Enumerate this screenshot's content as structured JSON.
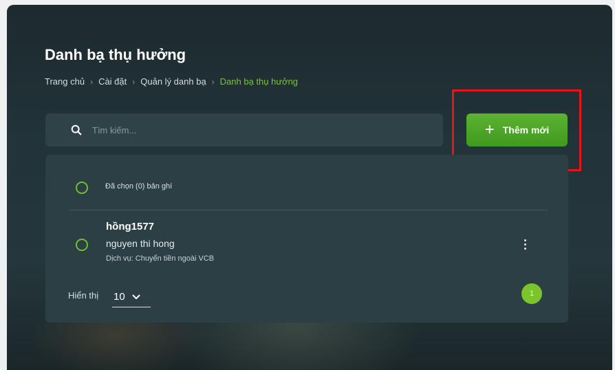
{
  "page": {
    "title": "Danh bạ thụ hưởng"
  },
  "breadcrumb": [
    {
      "label": "Trang chủ"
    },
    {
      "label": "Cài đặt"
    },
    {
      "label": "Quản lý danh bạ"
    },
    {
      "label": "Danh bạ thụ hưởng"
    }
  ],
  "breadcrumb_separator": "›",
  "search": {
    "placeholder": "Tìm kiếm...",
    "icon": "search-icon"
  },
  "add_button": {
    "label": "Thêm mới",
    "icon": "plus-icon"
  },
  "list": {
    "selected_label": "Đã chọn (0) bản ghí",
    "rows": [
      {
        "name": "hồng1577",
        "full_name": "nguyen thi hong",
        "service": "Dịch vụ: Chuyển tiền ngoài VCB"
      }
    ]
  },
  "pagination": {
    "show_label": "Hiển thị",
    "page_size": "10",
    "current_page": "1"
  },
  "colors": {
    "accent": "#5db231",
    "highlight_box": "#e8141c",
    "breadcrumb_active": "#7cc23a"
  }
}
